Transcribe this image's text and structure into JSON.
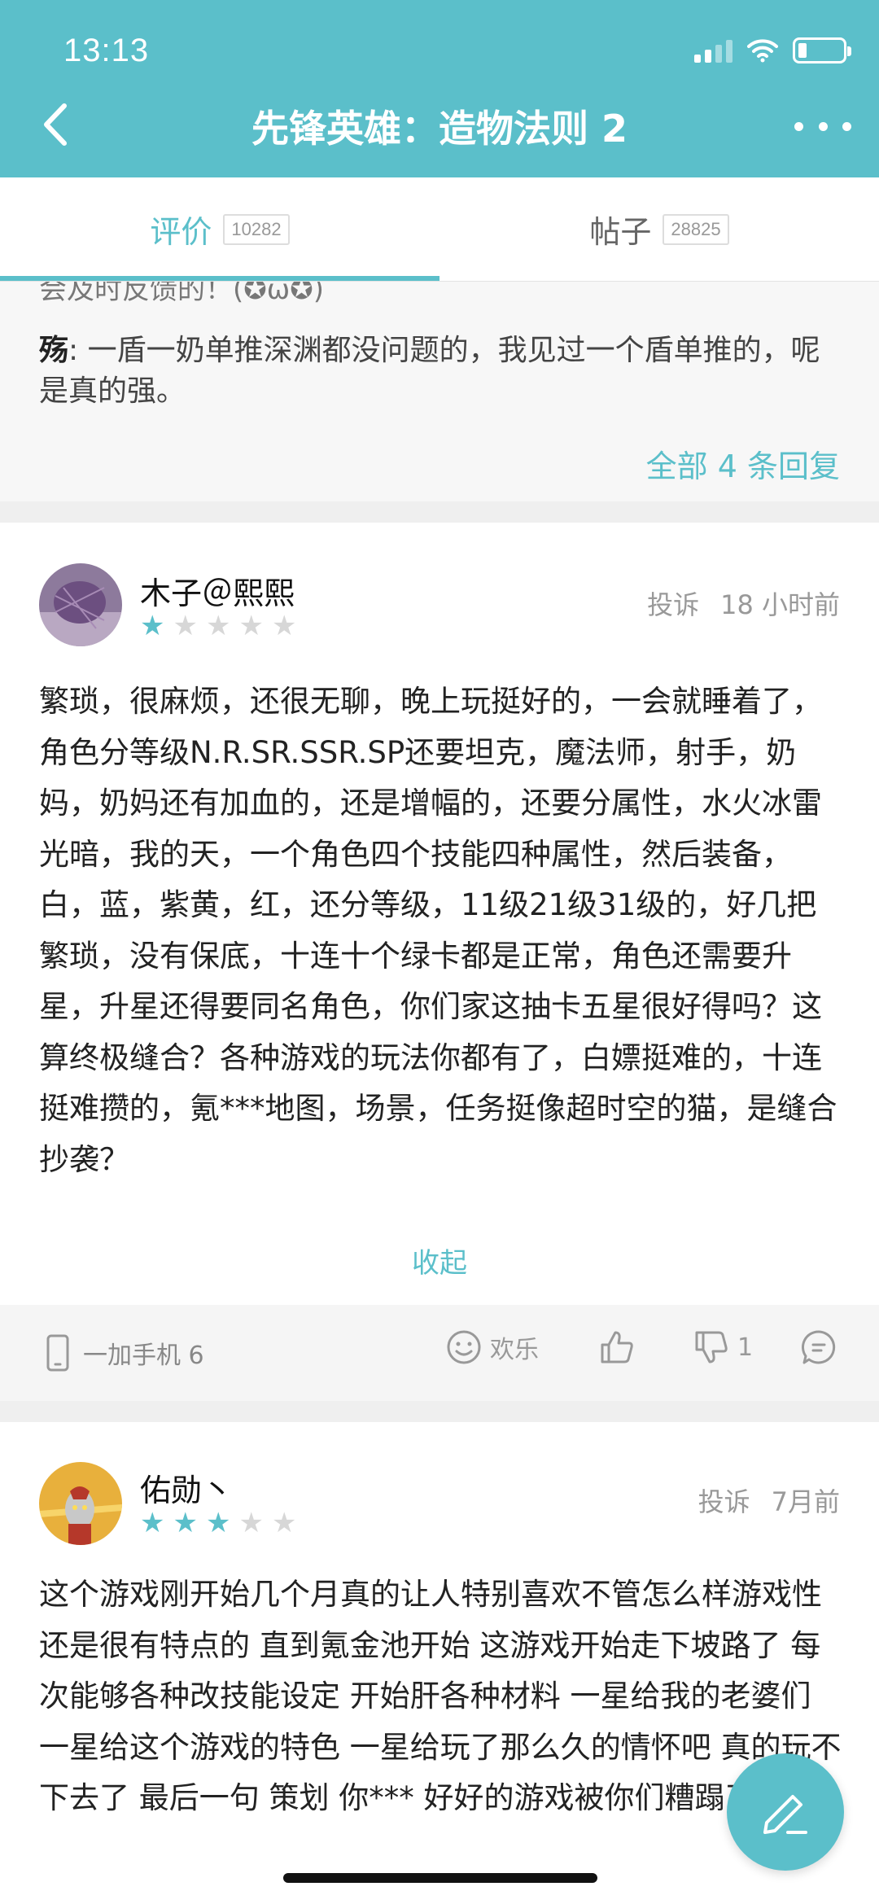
{
  "status_bar": {
    "time": "13:13"
  },
  "header": {
    "title": "先锋英雄：造物法则 2"
  },
  "tabs": [
    {
      "label": "评价",
      "count": "10282"
    },
    {
      "label": "帖子",
      "count": "28825"
    }
  ],
  "reply": {
    "partial_text": "会及时反馈的！(✪ω✪)",
    "author": "殇",
    "text": ": 一盾一奶单推深渊都没问题的，我见过一个盾单推的，呢是真的强。",
    "more_link": "全部 4 条回复"
  },
  "reviews": [
    {
      "username": "木子＠熙熙",
      "rating": 1,
      "report": "投诉",
      "time": "18 小时前",
      "text": "繁琐，很麻烦，还很无聊，晚上玩挺好的，一会就睡着了，角色分等级N.R.SR.SSR.SP还要坦克，魔法师，射手，奶妈，奶妈还有加血的，还是增幅的，还要分属性，水火冰雷光暗，我的天，一个角色四个技能四种属性，然后装备，白，蓝，紫黄，红，还分等级，11级21级31级的，好几把繁琐，没有保底，十连十个绿卡都是正常，角色还需要升星，升星还得要同名角色，你们家这抽卡五星很好得吗？这算终极缝合？各种游戏的玩法你都有了，白嫖挺难的，十连挺难攒的，氪***地图，场景，任务挺像超时空的猫，是缝合抄袭？",
      "collapse": "收起",
      "device": "一加手机 6",
      "emotion": "欢乐",
      "dislikes": "1"
    },
    {
      "username": "佑勋丶",
      "rating": 3,
      "report": "投诉",
      "time": "7月前",
      "text": "这个游戏刚开始几个月真的让人特别喜欢不管怎么样游戏性还是很有特点的 直到氪金池开始 这游戏开始走下坡路了 每次能够各种改技能设定 开始肝各种材料 一星给我的老婆们 一星给这个游戏的特色 一星给玩了那么久的情怀吧 真的玩不下去了 最后一句 策划 你*** 好好的游戏被你们糟蹋了"
    }
  ],
  "colors": {
    "accent": "#5bbfca",
    "star_off": "#d7d7d7"
  }
}
